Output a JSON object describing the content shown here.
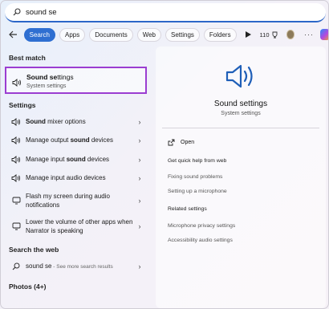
{
  "search": {
    "query": "sound se"
  },
  "filters": {
    "chips": [
      "Search",
      "Apps",
      "Documents",
      "Web",
      "Settings",
      "Folders"
    ],
    "points": "110"
  },
  "left": {
    "best_match_header": "Best match",
    "best_match": {
      "title_bold": "Sound se",
      "title_rest": "ttings",
      "subtitle": "System settings"
    },
    "settings_header": "Settings",
    "settings_items": [
      {
        "pre": "",
        "bold": "Sound",
        "post": " mixer options"
      },
      {
        "pre": "Manage output ",
        "bold": "sound",
        "post": " devices"
      },
      {
        "pre": "Manage input ",
        "bold": "sound",
        "post": " devices"
      },
      {
        "pre": "Manage input audio devices",
        "bold": "",
        "post": ""
      },
      {
        "pre": "Flash my screen during audio notifications",
        "bold": "",
        "post": ""
      },
      {
        "pre": "Lower the volume of other apps when Narrator is speaking",
        "bold": "",
        "post": ""
      }
    ],
    "web_header": "Search the web",
    "web_item": {
      "query": "sound se",
      "suffix": " - See more search results"
    },
    "photos_header": "Photos (4+)"
  },
  "right": {
    "title": "Sound settings",
    "subtitle": "System settings",
    "open": "Open",
    "quick_help": "Get quick help from web",
    "help_links": [
      "Fixing sound problems",
      "Setting up a microphone"
    ],
    "related_header": "Related settings",
    "related_links": [
      "Microphone privacy settings",
      "Accessibility audio settings"
    ]
  }
}
